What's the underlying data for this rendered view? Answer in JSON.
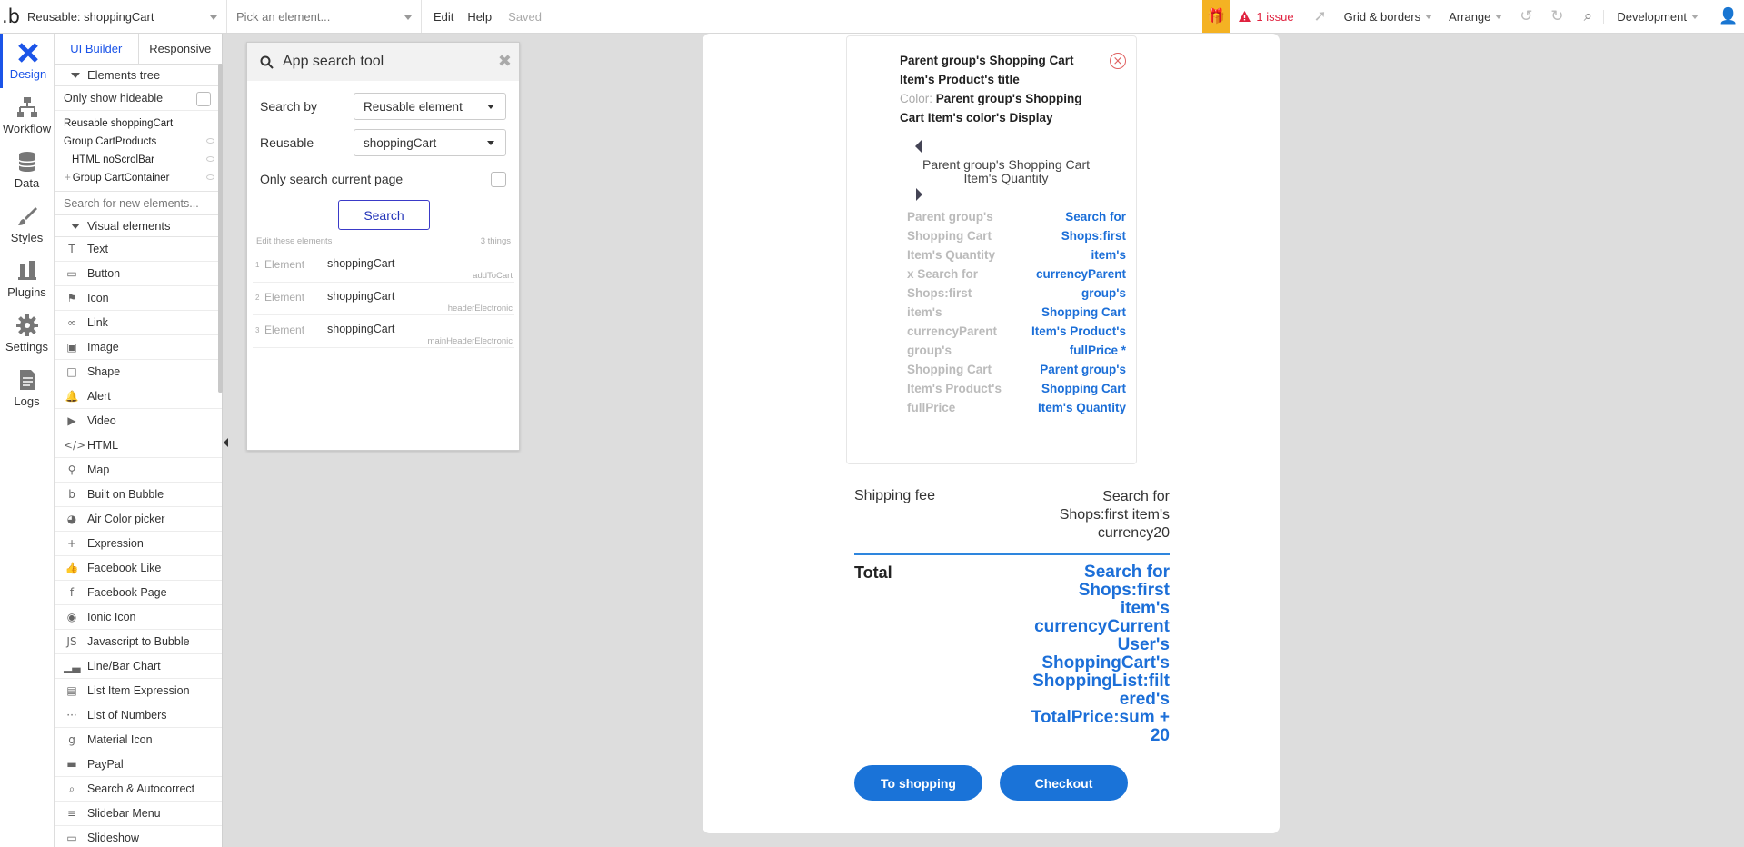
{
  "topbar": {
    "page_selector": "Reusable: shoppingCart",
    "element_placeholder": "Pick an element...",
    "menu_edit": "Edit",
    "menu_help": "Help",
    "save_status": "Saved",
    "issues": "1 issue",
    "grid_borders": "Grid & borders",
    "arrange": "Arrange",
    "environment": "Development"
  },
  "left_nav": [
    {
      "label": "Design",
      "icon": "design-icon"
    },
    {
      "label": "Workflow",
      "icon": "workflow-icon"
    },
    {
      "label": "Data",
      "icon": "data-icon"
    },
    {
      "label": "Styles",
      "icon": "styles-icon"
    },
    {
      "label": "Plugins",
      "icon": "plugins-icon"
    },
    {
      "label": "Settings",
      "icon": "settings-icon"
    },
    {
      "label": "Logs",
      "icon": "logs-icon"
    }
  ],
  "panel": {
    "tab_ui_builder": "UI Builder",
    "tab_responsive": "Responsive",
    "elements_tree_header": "Elements tree",
    "only_show_hideable": "Only show hideable",
    "tree": [
      "Reusable shoppingCart",
      "Group CartProducts",
      "HTML noScrolBar",
      "Group CartContainer"
    ],
    "search_placeholder": "Search for new elements...",
    "visual_elements_header": "Visual elements",
    "visual_elements": [
      {
        "label": "Text",
        "icon": "T"
      },
      {
        "label": "Button",
        "icon": "▭"
      },
      {
        "label": "Icon",
        "icon": "⚑"
      },
      {
        "label": "Link",
        "icon": "∞"
      },
      {
        "label": "Image",
        "icon": "▣"
      },
      {
        "label": "Shape",
        "icon": "□"
      },
      {
        "label": "Alert",
        "icon": "🔔"
      },
      {
        "label": "Video",
        "icon": "▶"
      },
      {
        "label": "HTML",
        "icon": "</>"
      },
      {
        "label": "Map",
        "icon": "⚲"
      },
      {
        "label": "Built on Bubble",
        "icon": "b"
      },
      {
        "label": "Air Color picker",
        "icon": "◕"
      },
      {
        "label": "Expression",
        "icon": "+"
      },
      {
        "label": "Facebook Like",
        "icon": "👍"
      },
      {
        "label": "Facebook Page",
        "icon": "f"
      },
      {
        "label": "Ionic Icon",
        "icon": "◉"
      },
      {
        "label": "Javascript to Bubble",
        "icon": "JS"
      },
      {
        "label": "Line/Bar Chart",
        "icon": "▁▃"
      },
      {
        "label": "List Item Expression",
        "icon": "▤"
      },
      {
        "label": "List of Numbers",
        "icon": "···"
      },
      {
        "label": "Material Icon",
        "icon": "g"
      },
      {
        "label": "PayPal",
        "icon": "▬"
      },
      {
        "label": "Search & Autocorrect",
        "icon": "⌕"
      },
      {
        "label": "Slidebar Menu",
        "icon": "≡"
      },
      {
        "label": "Slideshow",
        "icon": "▭"
      }
    ]
  },
  "search_tool": {
    "title": "App search tool",
    "search_by_label": "Search by",
    "search_by_value": "Reusable element",
    "reusable_label": "Reusable",
    "reusable_value": "shoppingCart",
    "only_current_page": "Only search current page",
    "search_button": "Search",
    "results_header": "Edit these elements",
    "results_count": "3 things",
    "results": [
      {
        "num": "1",
        "type": "Element",
        "name": "shoppingCart",
        "parent": "addToCart"
      },
      {
        "num": "2",
        "type": "Element",
        "name": "shoppingCart",
        "parent": "headerElectronic"
      },
      {
        "num": "3",
        "type": "Element",
        "name": "shoppingCart",
        "parent": "mainHeaderElectronic"
      }
    ]
  },
  "cart": {
    "product_title_lines": [
      "Parent group's Shopping Cart",
      "Item's Product's title"
    ],
    "color_label": "Color: ",
    "color_value_lines": [
      "Parent group's Shopping",
      "Cart Item's color's Display"
    ],
    "quantity_lines": [
      "Parent group's Shopping Cart",
      "Item's Quantity"
    ],
    "calc_left_lines": [
      "Parent group's",
      "Shopping Cart",
      "Item's Quantity",
      "x Search for",
      "Shops:first",
      "item's",
      "currencyParent",
      "group's",
      "Shopping Cart",
      "Item's Product's",
      "fullPrice"
    ],
    "calc_right_lines": [
      "Search for",
      "Shops:first",
      "item's",
      "currencyParent",
      "group's",
      "Shopping Cart",
      "Item's Product's",
      "fullPrice *",
      "Parent group's",
      "Shopping Cart",
      "Item's Quantity"
    ],
    "shipping_label": "Shipping fee",
    "shipping_value_lines": [
      "Search for",
      "Shops:first item's",
      "currency20"
    ],
    "total_label": "Total",
    "total_value_lines": [
      "Search for",
      "Shops:first",
      "item's",
      "currencyCurrent",
      "User's",
      "ShoppingCart's",
      "ShoppingList:filt",
      "ered's",
      "TotalPrice:sum +",
      "20"
    ],
    "to_shopping_button": "To shopping",
    "checkout_button": "Checkout"
  }
}
